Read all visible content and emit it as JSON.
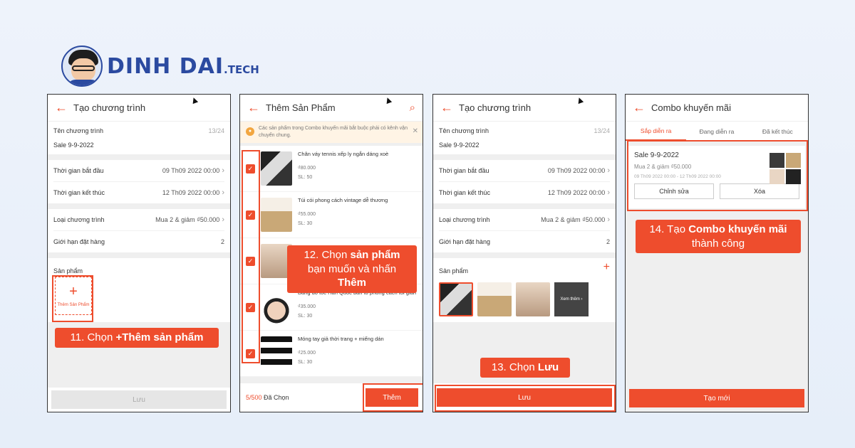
{
  "brand": {
    "name": "DINH DAI",
    "suffix": ".TECH"
  },
  "phone1": {
    "title": "Tạo chương trình",
    "name_label": "Tên chương trình",
    "name_count": "13/24",
    "name_value": "Sale 9-9-2022",
    "start_label": "Thời gian bắt đầu",
    "start_value": "09 Th09 2022 00:00",
    "end_label": "Thời gian kết thúc",
    "end_value": "12 Th09 2022 00:00",
    "type_label": "Loại chương trình",
    "type_value": "Mua 2 & giảm ₫50.000",
    "limit_label": "Giới hạn đặt hàng",
    "limit_value": "2",
    "products_label": "Sản phẩm",
    "add_plus": "+",
    "add_label": "Thêm Sản Phẩm",
    "save_label": "Lưu",
    "callout_pre": "11. Chọn ",
    "callout_bold": "+Thêm sản phẩm"
  },
  "phone2": {
    "title": "Thêm Sản Phẩm",
    "notice": "Các sản phẩm trong Combo khuyến mãi bắt buộc phải có kênh vận chuyển chung.",
    "notice_close": "✕",
    "items": [
      {
        "name": "Chân váy tennis xếp ly ngắn dáng xoè",
        "price": "₫80.000",
        "qty": "SL: 50"
      },
      {
        "name": "Túi cói phong cách vintage dễ thương",
        "price": "₫55.000",
        "qty": "SL: 30"
      },
      {
        "name": "",
        "price": "",
        "qty": ""
      },
      {
        "name": "Băng đô tóc Hàn Quốc bản to phong cách tối giản",
        "price": "₫35.000",
        "qty": "SL: 30"
      },
      {
        "name": "Móng tay giả thời trang + miếng dán",
        "price": "₫25.000",
        "qty": "SL: 30"
      }
    ],
    "selected_count": "5/500",
    "selected_label": " Đã Chọn",
    "add_label": "Thêm",
    "callout_line1_pre": "12. Chọn ",
    "callout_line1_bold": "sản phẩm",
    "callout_line2_pre": "bạn muốn và nhấn ",
    "callout_line2_bold": "Thêm"
  },
  "phone3": {
    "title": "Tạo chương trình",
    "name_label": "Tên chương trình",
    "name_count": "13/24",
    "name_value": "Sale 9-9-2022",
    "start_label": "Thời gian bắt đầu",
    "start_value": "09 Th09 2022 00:00",
    "end_label": "Thời gian kết thúc",
    "end_value": "12 Th09 2022 00:00",
    "type_label": "Loại chương trình",
    "type_value": "Mua 2 & giảm ₫50.000",
    "limit_label": "Giới hạn đặt hàng",
    "limit_value": "2",
    "products_label": "Sản phẩm",
    "add_plus": "+",
    "more_label": "Xem thêm ›",
    "save_label": "Lưu",
    "callout_pre": "13. Chọn ",
    "callout_bold": "Lưu"
  },
  "phone4": {
    "title": "Combo khuyến mãi",
    "tabs": [
      "Sắp diễn ra",
      "Đang diễn ra",
      "Đã kết thúc"
    ],
    "card_name": "Sale 9-9-2022",
    "card_desc": "Mua 2 & giảm ₫50.000",
    "card_time": "09 Th09 2022 00:00 - 12 Th09 2022 00:00",
    "edit_label": "Chỉnh sửa",
    "delete_label": "Xóa",
    "new_label": "Tạo mới",
    "callout_line1_pre": "14. Tạo ",
    "callout_line1_bold": "Combo khuyến mãi",
    "callout_line2": "thành công"
  },
  "colors": {
    "accent": "#ee4d2d",
    "brand": "#2b4aa0"
  }
}
